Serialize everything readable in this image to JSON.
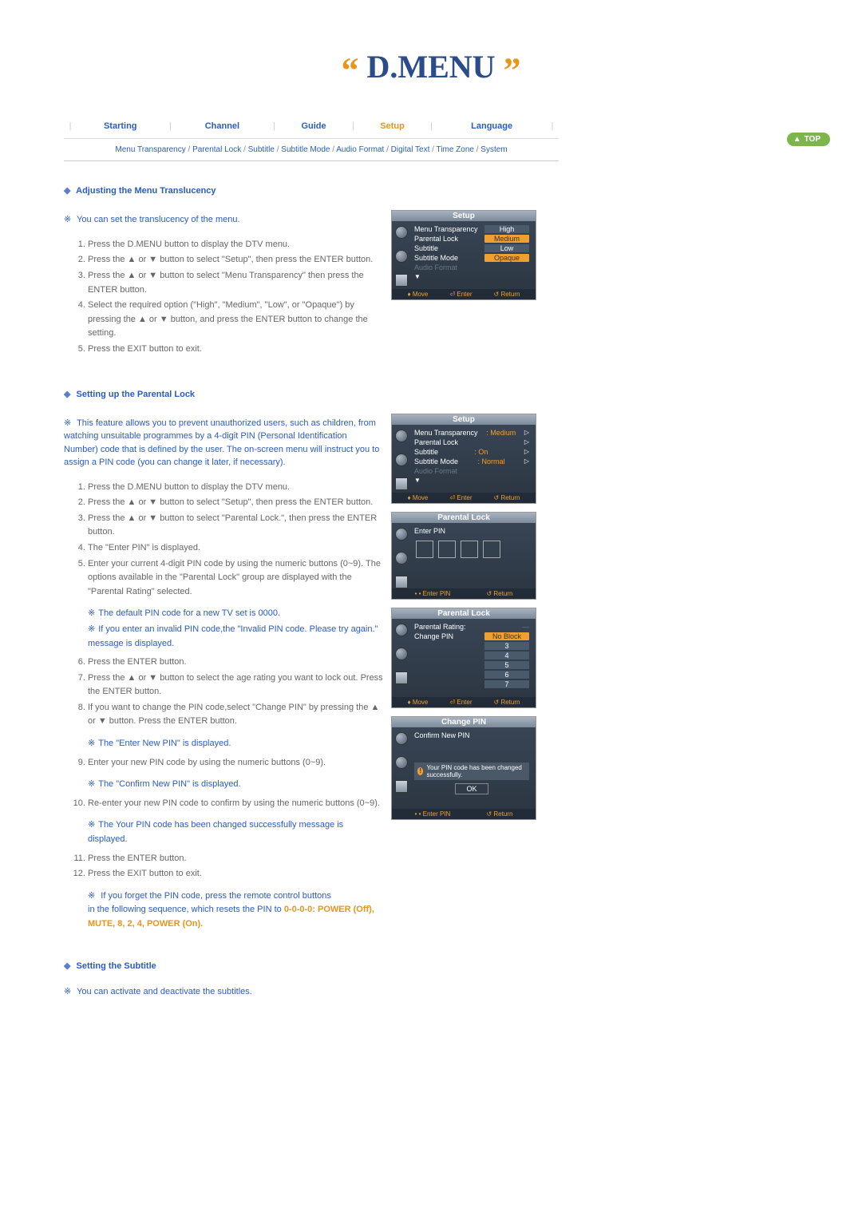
{
  "header": {
    "title": "D.MENU",
    "quote_open": "“",
    "quote_close": "”"
  },
  "nav": {
    "items": [
      "Starting",
      "Channel",
      "Guide",
      "Setup",
      "Language"
    ],
    "active_index": 3
  },
  "subnav": {
    "items": [
      "Menu Transparency",
      "Parental Lock",
      "Subtitle",
      "Subtitle Mode",
      "Audio Format",
      "Digital Text",
      "Time Zone",
      "System"
    ]
  },
  "top_button": "TOP",
  "section1": {
    "title": "Adjusting the Menu Translucency",
    "intro": "You can set the translucency of the menu.",
    "steps": [
      "Press the D.MENU button to display the DTV menu.",
      "Press the ▲ or ▼ button to select \"Setup\", then press the ENTER button.",
      "Press the ▲ or ▼ button to select \"Menu Transparency\" then press the ENTER button.",
      "Select the required option (\"High\", \"Medium\", \"Low\", or \"Opaque\") by pressing the ▲ or ▼ button, and press the ENTER button to change the setting.",
      "Press the EXIT button to exit."
    ]
  },
  "section2": {
    "title": "Setting up the Parental Lock",
    "intro": "This feature allows you to prevent unauthorized users, such as children, from watching unsuitable programmes by a 4-digit PIN (Personal Identification Number) code that is defined by the user. The on-screen menu will instruct you to assign a PIN code (you can change it later, if necessary).",
    "steps_a": [
      "Press the D.MENU button to display the DTV menu.",
      "Press the ▲ or ▼ button to select \"Setup\", then press the ENTER button.",
      "Press the ▲ or ▼ button to select \"Parental Lock.\", then press the ENTER button.",
      "The \"Enter PIN\" is displayed.",
      "Enter your current 4-digit PIN code by using the numeric buttons (0~9). The options available in the \"Parental Lock\" group are displayed with the \"Parental Rating\" selected."
    ],
    "notes_a": [
      "The default PIN code for a new TV set is 0000.",
      "If you enter an invalid PIN code,the \"Invalid PIN code. Please try again.\" message is displayed."
    ],
    "steps_b": [
      "Press the ENTER button.",
      "Press the ▲ or ▼ button to select the age rating you want to lock out. Press the ENTER button.",
      "If you want to change the PIN code,select \"Change PIN\" by pressing the ▲ or ▼ button. Press the ENTER button.",
      "Enter your new PIN code by using the numeric buttons (0~9).",
      "Re-enter your new PIN code to confirm by using the numeric buttons (0~9).",
      "Press the ENTER button.",
      "Press the EXIT button to exit."
    ],
    "inline_notes": {
      "n8": "The \"Enter New PIN\" is displayed.",
      "n9": "The \"Confirm New PIN\" is displayed.",
      "n10": "The Your PIN code has been changed successfully message is displayed."
    },
    "forget_note_1": "If you forget the PIN code, press the remote control buttons",
    "forget_note_2": "in the following sequence, which resets the PIN to ",
    "forget_bold": "0-0-0-0: POWER (Off), MUTE, 8, 2, 4, POWER (On)."
  },
  "section3": {
    "title": "Setting the Subtitle",
    "intro": "You can activate and deactivate the subtitles."
  },
  "osd1": {
    "title": "Setup",
    "rows": [
      {
        "label": "Menu Transparency",
        "options": [
          "High",
          "Medium",
          "Low",
          "Opaque"
        ],
        "selected": "Medium"
      },
      {
        "label": "Parental Lock"
      },
      {
        "label": "Subtitle"
      },
      {
        "label": "Subtitle Mode"
      },
      {
        "label": "Audio Format",
        "dim": true
      }
    ],
    "footer": [
      "♦ Move",
      "⏎ Enter",
      "↺ Return"
    ]
  },
  "osd2": {
    "title": "Setup",
    "rows": [
      {
        "label": "Menu Transparency",
        "value": ": Medium"
      },
      {
        "label": "Parental Lock",
        "value": ""
      },
      {
        "label": "Subtitle",
        "value": ": On"
      },
      {
        "label": "Subtitle Mode",
        "value": ": Normal"
      },
      {
        "label": "Audio Format",
        "dim": true
      }
    ],
    "footer": [
      "♦ Move",
      "⏎ Enter",
      "↺ Return"
    ]
  },
  "osd3": {
    "title": "Parental Lock",
    "enter_pin": "Enter PIN",
    "footer": [
      "• • Enter PIN",
      "↺ Return"
    ]
  },
  "osd4": {
    "title": "Parental Lock",
    "rows": [
      {
        "label": "Parental Rating:",
        "value": ""
      },
      {
        "label": "Change PIN",
        "options": [
          "No Block",
          "3",
          "4",
          "5",
          "6",
          "7"
        ],
        "selected": "No Block"
      }
    ],
    "footer": [
      "♦ Move",
      "⏎ Enter",
      "↺ Return"
    ]
  },
  "osd5": {
    "title": "Change PIN",
    "confirm_label": "Confirm New PIN",
    "message": "Your PIN code has been changed successfully.",
    "ok": "OK",
    "footer": [
      "• • Enter PIN",
      "↺ Return"
    ]
  }
}
